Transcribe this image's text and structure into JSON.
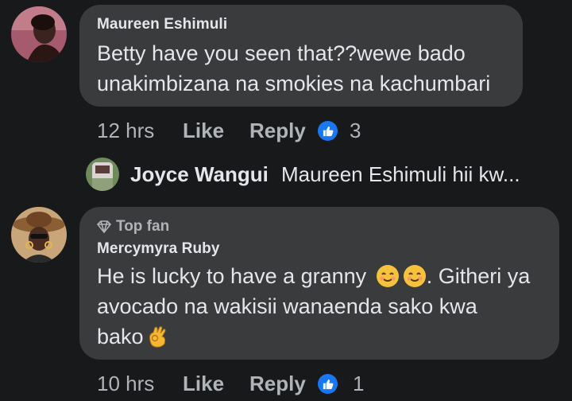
{
  "comments": [
    {
      "author": "Maureen Eshimuli",
      "text_line1": "Betty have you seen that??wewe bado",
      "text_line2": "unakimbizana na smokies na kachumbari",
      "time": "12 hrs",
      "like_label": "Like",
      "reply_label": "Reply",
      "reaction_count": "3",
      "reaction_icon": "thumbs-up-icon"
    },
    {
      "badge": "Top fan",
      "badge_icon": "diamond-icon",
      "author": "Mercymyra Ruby",
      "text_line1_part1": "He is lucky to have a granny",
      "text_line1_part2": ". Githeri ya",
      "text_line2": "avocado na wakisii wanaenda sako kwa",
      "text_line3": "bako",
      "time": "10 hrs",
      "like_label": "Like",
      "reply_label": "Reply",
      "reaction_count": "1",
      "reaction_icon": "thumbs-up-icon"
    }
  ],
  "reply_preview": {
    "author": "Joyce Wangui",
    "text": "Maureen Eshimuli hii kw..."
  },
  "colors": {
    "background": "#18191a",
    "bubble": "#3a3b3c",
    "primary_text": "#e4e6eb",
    "secondary_text": "#b0b3b8",
    "like_blue": "#1877f2"
  }
}
